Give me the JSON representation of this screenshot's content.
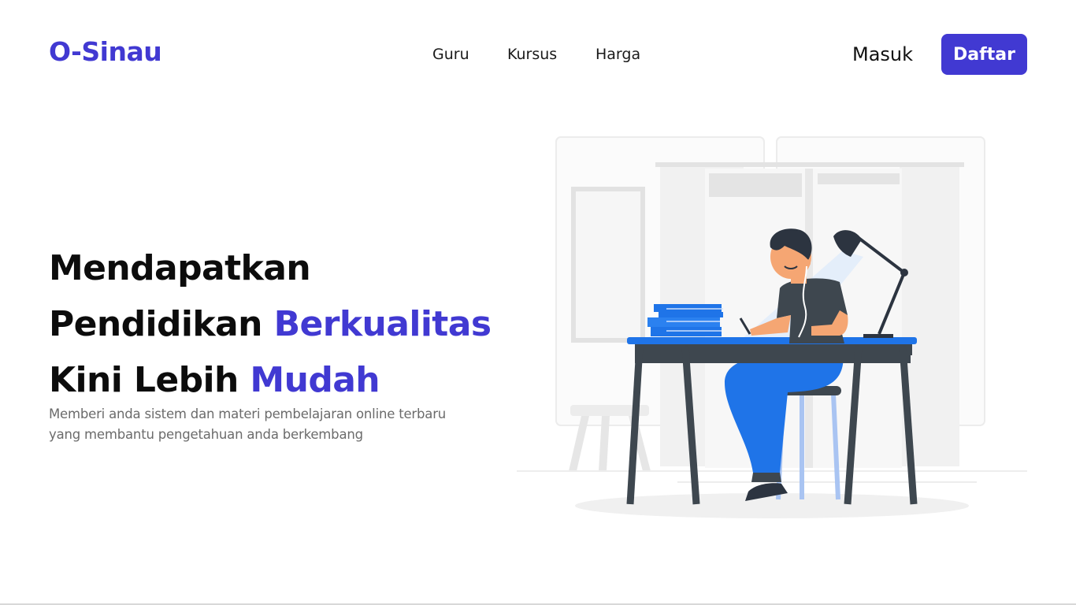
{
  "header": {
    "logo": {
      "part1": "O-Si",
      "part2": "nau"
    },
    "nav": [
      {
        "label": "Guru"
      },
      {
        "label": "Kursus"
      },
      {
        "label": "Harga"
      }
    ],
    "login_label": "Masuk",
    "signup_label": "Daftar"
  },
  "hero": {
    "title_line1": "Mendapatkan",
    "title_line2_plain": "Pendidikan ",
    "title_line2_accent": "Berkualitas",
    "title_line3_plain": "Kini Lebih ",
    "title_line3_accent": "Mudah",
    "subtitle_line1": "Memberi anda sistem dan materi pembelajaran online terbaru",
    "subtitle_line2": "yang membantu pengetahuan anda berkembang"
  },
  "colors": {
    "accent": "#4139d2",
    "text_dark": "#111111",
    "text_muted": "#6b6b6b",
    "illustration_blue": "#1f74e8",
    "illustration_dark": "#3e474f"
  },
  "icons": {
    "illustration": "student-studying-at-desk-illustration"
  }
}
